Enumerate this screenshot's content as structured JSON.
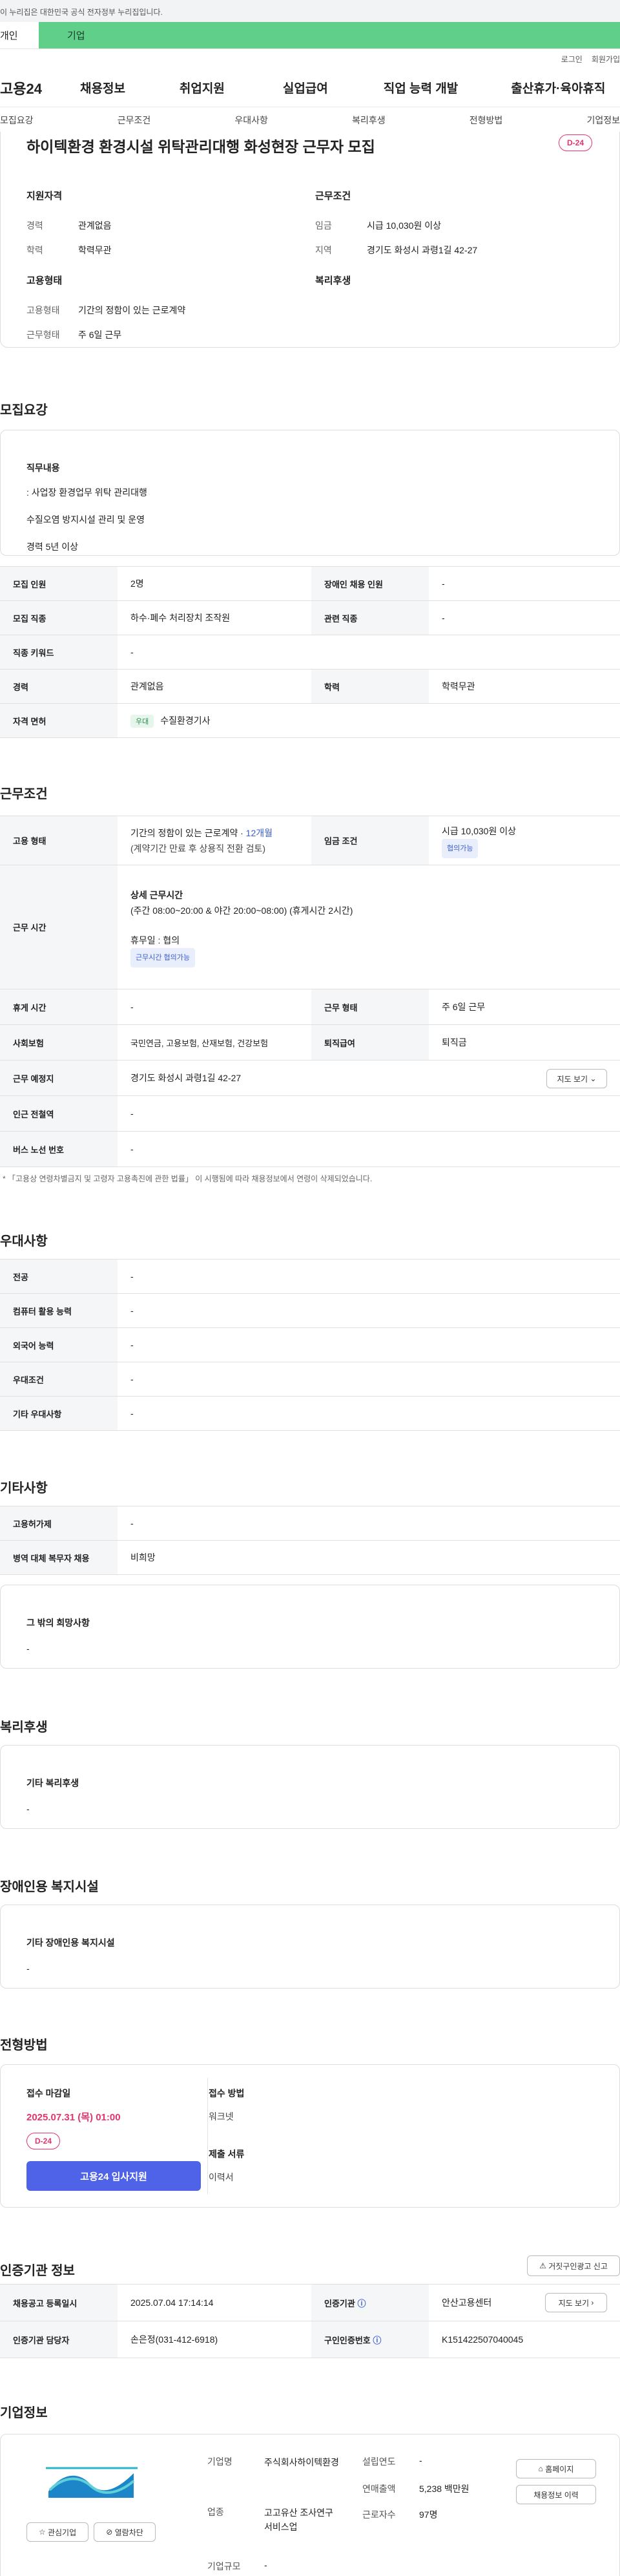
{
  "gov_banner": "이 누리집은 대한민국 공식 전자정부 누리집입니다.",
  "top_tabs": [
    "개인",
    "기업"
  ],
  "util": [
    "로그인",
    "회원가입"
  ],
  "gnb": {
    "logo": "고용24",
    "menu": [
      "채용정보",
      "취업지원",
      "실업급여",
      "직업 능력 개발",
      "출산휴가·육아휴직"
    ]
  },
  "anchors": [
    "모집요강",
    "근무조건",
    "우대사항",
    "복리후생",
    "전형방법",
    "기업정보"
  ],
  "summary": {
    "title": "하이텍환경 환경시설 위탁관리대행 화성현장 근무자 모집",
    "dday": "D-24",
    "qual_h": "지원자격",
    "qual": [
      {
        "k": "경력",
        "v": "관계없음"
      },
      {
        "k": "학력",
        "v": "학력무관"
      }
    ],
    "cond_h": "근무조건",
    "cond": [
      {
        "k": "임금",
        "v": "시급 10,030원 이상"
      },
      {
        "k": "지역",
        "v": "경기도 화성시 과령1길 42-27"
      }
    ],
    "emp_h": "고용형태",
    "emp": [
      {
        "k": "고용형태",
        "v": "기간의 정함이 있는 근로계약"
      },
      {
        "k": "근무형태",
        "v": "주 6일 근무"
      }
    ],
    "welfare_h": "복리후생"
  },
  "recruit": {
    "heading": "모집요강",
    "job_h": "직무내용",
    "job": [
      ": 사업장 환경업무 위탁 관리대행",
      "수질오염 방지시설 관리 및 운영",
      "경력 5년 이상"
    ],
    "rows": [
      [
        "모집 인원",
        "2명",
        "장애인 채용 인원",
        "-"
      ],
      [
        "모집 직종",
        "하수·폐수 처리장치 조작원",
        "관련 직종",
        "-"
      ],
      [
        "직종 키워드",
        "-"
      ],
      [
        "경력",
        "관계없음",
        "학력",
        "학력무관"
      ],
      [
        "자격 면허",
        "우대",
        "수질환경기사"
      ]
    ]
  },
  "work": {
    "heading": "근무조건",
    "emp_type_h": "고용 형태",
    "emp_type1": "기간의 정함이 있는 근로계약 · ",
    "emp_type_month": "12개월",
    "emp_type2": "(계약기간 만료 후 상용직 전환 검토)",
    "wage_h": "임금 조건",
    "wage": "시급 10,030원 이상",
    "wage_tag": "협의가능",
    "time_h": "근무 시간",
    "time1": "상세 근무시간",
    "time2": "(주간 08:00~20:00 & 야간 20:00~08:00) (휴게시간 2시간)",
    "time3": "휴무일 : 협의",
    "time_tag": "근무시간 협의가능",
    "rows": [
      [
        "휴게 시간",
        "-",
        "근무 형태",
        "주 6일 근무"
      ],
      [
        "사회보험",
        "국민연금, 고용보험, 산재보험, 건강보험",
        "퇴직급여",
        "퇴직금"
      ]
    ],
    "place_h": "근무 예정지",
    "place": "경기도 화성시 과령1길 42-27",
    "map_btn": "지도 보기",
    "station_h": "인근 전철역",
    "station": "-",
    "bus_h": "버스 노선 번호",
    "bus": "-",
    "note": "* 「고용상 연령차별금지 및 고령자 고용촉진에 관한 법률」 이 시행됨에 따라 채용정보에서 연령이 삭제되었습니다."
  },
  "prefer": {
    "heading": "우대사항",
    "rows": [
      [
        "전공",
        "-"
      ],
      [
        "컴퓨터 활용 능력",
        "-"
      ],
      [
        "외국어 능력",
        "-"
      ],
      [
        "우대조건",
        "-"
      ],
      [
        "기타 우대사항",
        "-"
      ]
    ]
  },
  "etc": {
    "heading": "기타사항",
    "rows": [
      [
        "고용허가제",
        "-"
      ],
      [
        "병역 대체 복무자 채용",
        "비희망"
      ]
    ],
    "hope_h": "그 밖의 희망사항",
    "hope": "-"
  },
  "welfare": {
    "heading": "복리후생",
    "h": "기타 복리후생",
    "v": "-"
  },
  "disabled": {
    "heading": "장애인용 복지시설",
    "h": "기타 장애인용 복지시설",
    "v": "-"
  },
  "select": {
    "heading": "전형방법",
    "deadline_h": "접수 마감일",
    "deadline": "2025.07.31 (목) 01:00",
    "dday": "D-24",
    "apply_btn": "고용24 입사지원",
    "method_h": "접수 방법",
    "method": "워크넷",
    "docs_h": "제출 서류",
    "docs": "이력서"
  },
  "cert": {
    "heading": "인증기관 정보",
    "report_btn": "거짓구인광고 신고",
    "rows": [
      [
        "채용공고 등록일시",
        "2025.07.04 17:14:14",
        "인증기관",
        "안산고용센터"
      ],
      [
        "인증기관 담당자",
        "손은정(031-412-6918)",
        "구인인증번호",
        "K151422507040045"
      ]
    ],
    "map_btn": "지도 보기"
  },
  "company": {
    "heading": "기업정보",
    "fav_btn": "관심기업",
    "block_btn": "열람차단",
    "name_h": "기업명",
    "name": "주식회사하이텍환경",
    "year_h": "설립연도",
    "year": "-",
    "biz_h": "업종",
    "biz": "고고유산 조사연구 서비스업",
    "sales_h": "연매출액",
    "sales": "5,238 백만원",
    "emp_h": "근로자수",
    "emp": "97명",
    "size_h": "기업규모",
    "size": "-",
    "home_btn": "홈페이지",
    "view_btn": "채용정보 이력"
  },
  "colors": {
    "accent": "#5fcf8a",
    "dday": "#e8336b",
    "apply": "#4f63e8",
    "blue": "#3c5ccf"
  }
}
